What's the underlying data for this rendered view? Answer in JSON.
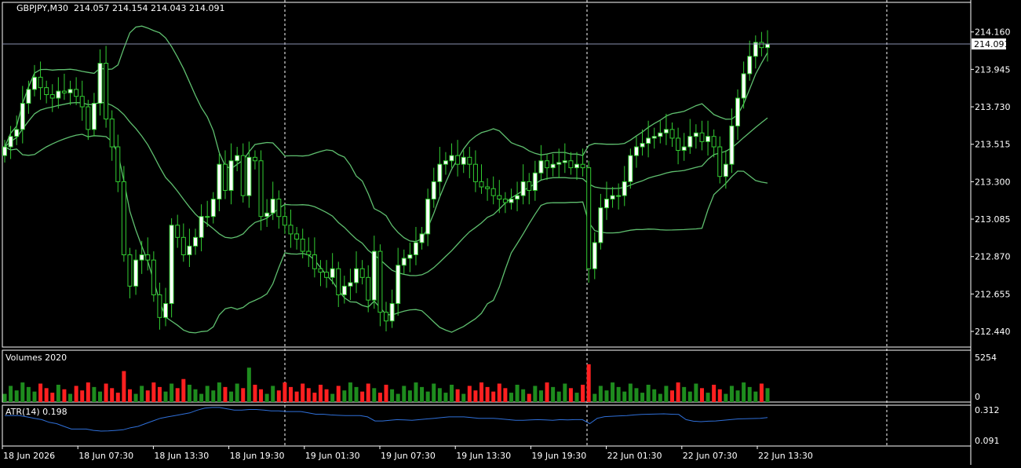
{
  "window": {
    "symbol_title": "GBPJPY,M30",
    "ohlc": "214.057 214.154 214.043 214.091"
  },
  "main_pane": {
    "price_ticks": [
      "214.160",
      "213.945",
      "213.730",
      "213.515",
      "213.300",
      "213.085",
      "212.870",
      "212.655",
      "212.440"
    ],
    "current_price": "214.091"
  },
  "volume_pane": {
    "title": "Volumes 2020",
    "ticks": [
      "5254",
      "0"
    ]
  },
  "atr_pane": {
    "title": "ATR(14) 0.198",
    "ticks": [
      "0.312",
      "0.091"
    ]
  },
  "time_axis": {
    "labels": [
      "18 Jun 2026",
      "18 Jun 07:30",
      "18 Jun 13:30",
      "18 Jun 19:30",
      "19 Jun 01:30",
      "19 Jun 07:30",
      "19 Jun 13:30",
      "19 Jun 19:30",
      "22 Jun 01:30",
      "22 Jun 07:30",
      "22 Jun 13:30"
    ]
  },
  "colors": {
    "background": "#000000",
    "axis": "#ffffff",
    "bollinger": "#5fbf6f",
    "bull_candle": "#ffffff",
    "bear_candle": "#000000",
    "candle_outline": "#32cd32",
    "volume_up": "#1e8c1e",
    "volume_down": "#ff2020",
    "atr_line": "#2f6fd8",
    "price_line": "#8a8fb0",
    "separator": "#ffffff"
  },
  "chart_data": [
    {
      "type": "candlestick",
      "title": "GBPJPY,M30",
      "ylim": [
        212.35,
        214.33
      ],
      "close": [
        213.5,
        213.56,
        213.6,
        213.75,
        213.83,
        213.9,
        213.84,
        213.8,
        213.78,
        213.82,
        213.81,
        213.83,
        213.79,
        213.73,
        213.6,
        213.75,
        213.98,
        213.66,
        213.5,
        213.3,
        212.88,
        212.7,
        212.85,
        212.88,
        212.85,
        212.65,
        212.52,
        212.6,
        213.05,
        212.98,
        212.88,
        212.93,
        212.98,
        213.1,
        213.1,
        213.2,
        213.4,
        213.25,
        213.42,
        213.45,
        213.22,
        213.44,
        213.42,
        213.1,
        213.12,
        213.2,
        213.1,
        213.05,
        213.0,
        212.97,
        212.9,
        212.88,
        212.8,
        212.78,
        212.75,
        212.8,
        212.65,
        212.7,
        212.72,
        212.8,
        212.75,
        212.62,
        212.9,
        212.55,
        212.5,
        212.6,
        212.82,
        212.86,
        212.88,
        212.95,
        213.0,
        213.2,
        213.3,
        213.4,
        213.42,
        213.45,
        213.4,
        213.44,
        213.4,
        213.3,
        213.27,
        213.26,
        213.22,
        213.2,
        213.18,
        213.2,
        213.22,
        213.3,
        213.25,
        213.35,
        213.42,
        213.38,
        213.4,
        213.41,
        213.42,
        213.38,
        213.4,
        213.38,
        212.8,
        212.95,
        213.15,
        213.2,
        213.22,
        213.22,
        213.3,
        213.45,
        213.5,
        213.52,
        213.55,
        213.56,
        213.58,
        213.6,
        213.55,
        213.48,
        213.5,
        213.56,
        213.58,
        213.53,
        213.56,
        213.5,
        213.33,
        213.4,
        213.62,
        213.78,
        213.92,
        214.02,
        214.1,
        214.07,
        214.09
      ],
      "open_delta_note": "open ≈ previous close; bull = white body, bear = black body with green outline"
    },
    {
      "type": "bar",
      "title": "Volumes 2020",
      "ylim": [
        0,
        5254
      ]
    },
    {
      "type": "line",
      "title": "ATR(14) 0.198",
      "ylim": [
        0.091,
        0.312
      ],
      "values": [
        0.27,
        0.27,
        0.27,
        0.26,
        0.25,
        0.24,
        0.22,
        0.21,
        0.19,
        0.17,
        0.17,
        0.17,
        0.16,
        0.155,
        0.157,
        0.16,
        0.165,
        0.18,
        0.19,
        0.21,
        0.23,
        0.25,
        0.26,
        0.27,
        0.28,
        0.29,
        0.31,
        0.325,
        0.33,
        0.33,
        0.32,
        0.31,
        0.31,
        0.315,
        0.315,
        0.31,
        0.305,
        0.305,
        0.3,
        0.3,
        0.3,
        0.29,
        0.28,
        0.28,
        0.275,
        0.272,
        0.27,
        0.27,
        0.27,
        0.26,
        0.23,
        0.23,
        0.235,
        0.24,
        0.238,
        0.235,
        0.24,
        0.245,
        0.25,
        0.255,
        0.26,
        0.26,
        0.26,
        0.255,
        0.25,
        0.25,
        0.25,
        0.245,
        0.24,
        0.235,
        0.235,
        0.238,
        0.24,
        0.238,
        0.235,
        0.24,
        0.238,
        0.24,
        0.24,
        0.21,
        0.25,
        0.262,
        0.265,
        0.268,
        0.27,
        0.275,
        0.278,
        0.28,
        0.282,
        0.283,
        0.28,
        0.278,
        0.24,
        0.228,
        0.225,
        0.228,
        0.23,
        0.235,
        0.24,
        0.245,
        0.247,
        0.248,
        0.25,
        0.255
      ]
    }
  ]
}
